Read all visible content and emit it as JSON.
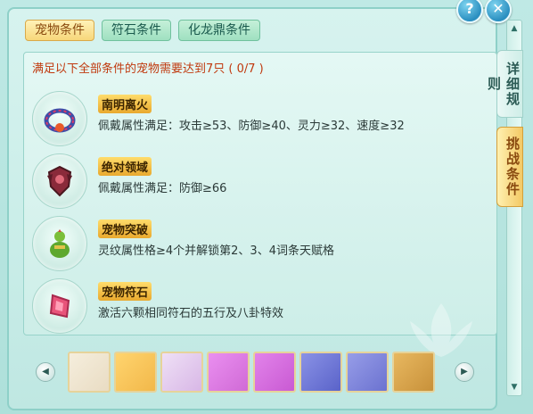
{
  "window": {
    "help_label": "?",
    "close_label": "✕"
  },
  "tabs": [
    {
      "label": "宠物条件",
      "active": true
    },
    {
      "label": "符石条件",
      "active": false
    },
    {
      "label": "化龙鼎条件",
      "active": false
    }
  ],
  "header": {
    "text": "满足以下全部条件的宠物需要达到7只",
    "count": "( 0/7 )"
  },
  "conditions": [
    {
      "title": "南明离火",
      "desc": "佩戴属性满足：攻击≥53、防御≥40、灵力≥32、速度≥32",
      "icon": "fire-ring-icon"
    },
    {
      "title": "绝对领域",
      "desc": "佩戴属性满足：防御≥66",
      "icon": "armor-icon"
    },
    {
      "title": "宠物突破",
      "desc": "灵纹属性格≥4个并解锁第2、3、4词条天赋格",
      "icon": "gourd-icon"
    },
    {
      "title": "宠物符石",
      "desc": "激活六颗相同符石的五行及八卦特效",
      "icon": "rune-stone-icon"
    }
  ],
  "pet_strip": {
    "prev_label": "◀",
    "next_label": "▶",
    "pets": [
      {
        "name": "pet-portrait-1",
        "color": "#e9dcc3"
      },
      {
        "name": "pet-portrait-2",
        "color": "#f2b84a"
      },
      {
        "name": "pet-portrait-3",
        "color": "#d8b7e6"
      },
      {
        "name": "pet-portrait-4",
        "color": "#d06ad6"
      },
      {
        "name": "pet-portrait-5",
        "color": "#c95ad3"
      },
      {
        "name": "pet-portrait-6",
        "color": "#5a63c9"
      },
      {
        "name": "pet-portrait-7",
        "color": "#6b72d0"
      },
      {
        "name": "pet-portrait-8",
        "color": "#c8913a"
      }
    ]
  },
  "side_tabs": [
    {
      "label": "详细规则",
      "active": false
    },
    {
      "label": "挑战条件",
      "active": true
    }
  ],
  "scrollbar": {
    "up": "▲",
    "down": "▼"
  }
}
